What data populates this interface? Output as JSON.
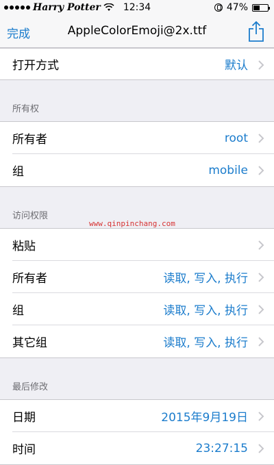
{
  "status_bar": {
    "carrier": "Harry Potter",
    "time": "12:34",
    "battery": "47%",
    "battery_level": 0.47
  },
  "nav": {
    "done_label": "完成",
    "title": "AppleColorEmoji@2x.ttf",
    "share_icon": "share-icon"
  },
  "open_with": {
    "label": "打开方式",
    "value": "默认"
  },
  "ownership": {
    "header": "所有权",
    "rows": [
      {
        "label": "所有者",
        "value": "root"
      },
      {
        "label": "组",
        "value": "mobile"
      }
    ]
  },
  "permissions": {
    "header": "访问权限",
    "rows": [
      {
        "label": "粘贴",
        "value": ""
      },
      {
        "label": "所有者",
        "value": "读取, 写入, 执行"
      },
      {
        "label": "组",
        "value": "读取, 写入, 执行"
      },
      {
        "label": "其它组",
        "value": "读取, 写入, 执行"
      }
    ]
  },
  "last_modified": {
    "header": "最后修改",
    "rows": [
      {
        "label": "日期",
        "value": "2015年9月19日"
      },
      {
        "label": "时间",
        "value": "23:27:15"
      }
    ]
  },
  "watermark": "www.qinpinchang.com",
  "colors": {
    "accent": "#1b7ccc",
    "background": "#efeff4"
  }
}
